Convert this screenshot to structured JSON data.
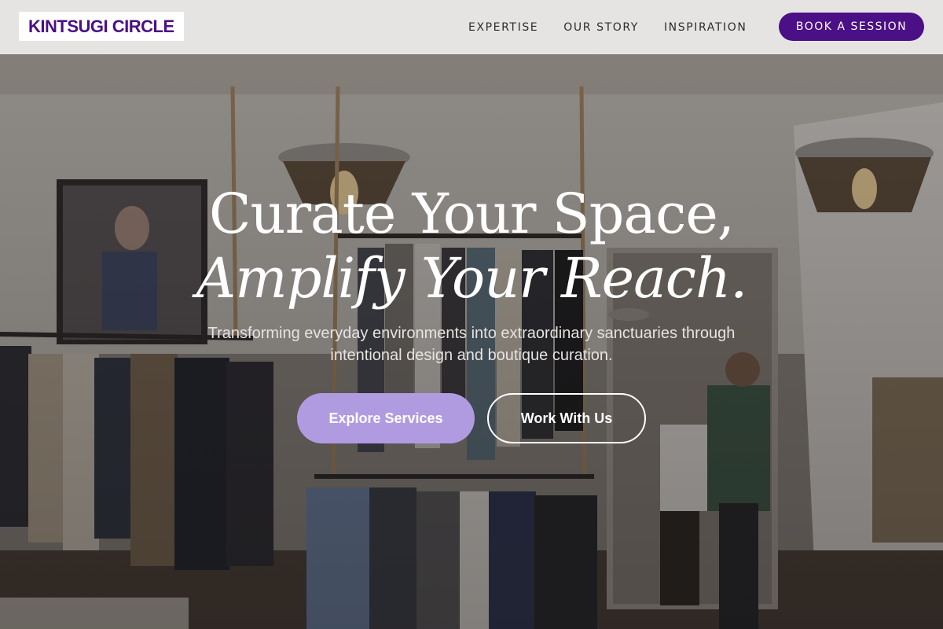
{
  "brand": {
    "logo_text": "KINTSUGI CIRCLE",
    "accent": "#4b0f86",
    "soft_accent": "#b19be0"
  },
  "nav": {
    "links": [
      {
        "label": "EXPERTISE"
      },
      {
        "label": "OUR STORY"
      },
      {
        "label": "INSPIRATION"
      }
    ],
    "cta_label": "BOOK A SESSION"
  },
  "hero": {
    "headline_line1": "Curate Your Space,",
    "headline_line2": "Amplify Your Reach.",
    "subtext": "Transforming everyday environments into extraordinary sanctuaries through intentional design and boutique curation.",
    "primary_cta": "Explore Services",
    "secondary_cta": "Work With Us"
  }
}
